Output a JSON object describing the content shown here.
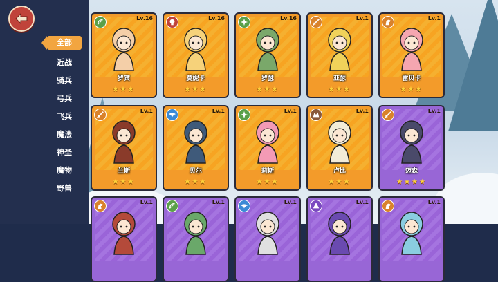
{
  "sidebar": {
    "categories": [
      "全部",
      "近战",
      "骑兵",
      "弓兵",
      "飞兵",
      "魔法",
      "神圣",
      "魔物",
      "野兽"
    ]
  },
  "colors": {
    "card_orange": "#f39b2a",
    "card_purple": "#9866d6",
    "sidebar_bg": "#232f4e",
    "active_tab": "#f2a540",
    "back_button": "#c0433a"
  },
  "heroes": [
    {
      "name": "罗宾",
      "level": "Lv.16",
      "stars": "★★★",
      "class_icon": "bow-icon",
      "rarity": "orange"
    },
    {
      "name": "莫妮卡",
      "level": "Lv.16",
      "stars": "★★★",
      "class_icon": "skull-icon",
      "rarity": "orange"
    },
    {
      "name": "罗瑟",
      "level": "Lv.16",
      "stars": "★★★",
      "class_icon": "sparkle-icon",
      "rarity": "orange"
    },
    {
      "name": "亚瑟",
      "level": "Lv.1",
      "stars": "★★★",
      "class_icon": "sword-icon",
      "rarity": "orange"
    },
    {
      "name": "雷贝卡",
      "level": "Lv.1",
      "stars": "★★★",
      "class_icon": "horse-icon",
      "rarity": "orange"
    },
    {
      "name": "兰斯",
      "level": "Lv.1",
      "stars": "★★★",
      "class_icon": "sword-icon",
      "rarity": "orange"
    },
    {
      "name": "贝尔",
      "level": "Lv.1",
      "stars": "★★★",
      "class_icon": "wing-icon",
      "rarity": "orange"
    },
    {
      "name": "莉斯",
      "level": "Lv.1",
      "stars": "★★★",
      "class_icon": "sparkle-icon",
      "rarity": "orange"
    },
    {
      "name": "卢比",
      "level": "Lv.1",
      "stars": "★★★",
      "class_icon": "beast-icon",
      "rarity": "orange"
    },
    {
      "name": "迈森",
      "level": "Lv.1",
      "stars": "★★★★",
      "class_icon": "sword-icon",
      "rarity": "purple"
    },
    {
      "name": "",
      "level": "Lv.1",
      "stars": "",
      "class_icon": "horse-icon",
      "rarity": "purple"
    },
    {
      "name": "",
      "level": "Lv.1",
      "stars": "",
      "class_icon": "bow-icon",
      "rarity": "purple"
    },
    {
      "name": "",
      "level": "Lv.1",
      "stars": "",
      "class_icon": "wing-icon",
      "rarity": "purple"
    },
    {
      "name": "",
      "level": "Lv.1",
      "stars": "",
      "class_icon": "hat-icon",
      "rarity": "purple"
    },
    {
      "name": "",
      "level": "Lv.1",
      "stars": "",
      "class_icon": "horse-icon",
      "rarity": "purple"
    }
  ]
}
